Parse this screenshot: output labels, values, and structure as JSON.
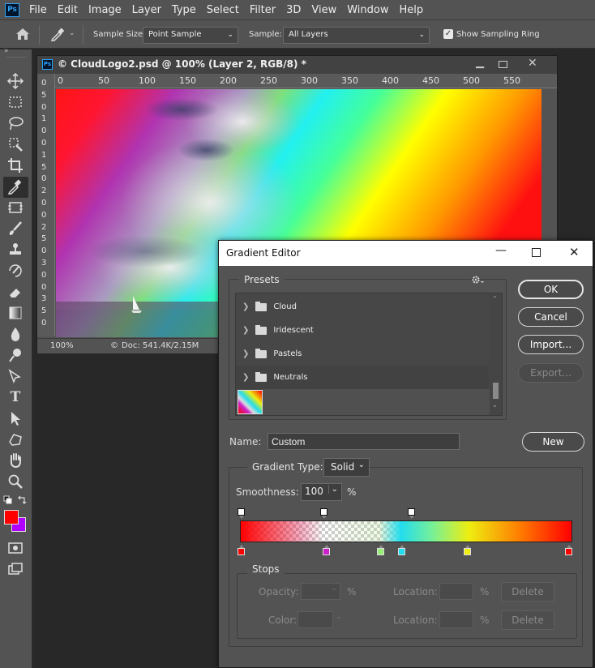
{
  "app": {
    "logo_text": "Ps"
  },
  "menu": [
    "File",
    "Edit",
    "Image",
    "Layer",
    "Type",
    "Select",
    "Filter",
    "3D",
    "View",
    "Window",
    "Help"
  ],
  "options_bar": {
    "sample_size_label": "Sample Size:",
    "sample_size_value": "Point Sample",
    "sample_label": "Sample:",
    "sample_value": "All Layers",
    "show_ring_label": "Show Sampling Ring",
    "show_ring_checked": true
  },
  "document": {
    "title": "© CloudLogo2.psd @ 100% (Layer 2, RGB/8) *",
    "ruler_h": [
      "0",
      "50",
      "100",
      "150",
      "200",
      "250",
      "300",
      "350",
      "400",
      "450",
      "500",
      "550"
    ],
    "ruler_v": [
      "0",
      "5",
      "0",
      "1",
      "0",
      "0",
      "1",
      "5",
      "0",
      "2",
      "0",
      "0",
      "2",
      "5",
      "0",
      "3",
      "0",
      "0",
      "3",
      "5",
      "0"
    ],
    "zoom": "100%",
    "doc_info": "Doc: 541.4K/2.15M"
  },
  "gradient_editor": {
    "title": "Gradient Editor",
    "presets_label": "Presets",
    "preset_folders": [
      "Cloud",
      "Iridescent",
      "Pastels",
      "Neutrals"
    ],
    "buttons": {
      "ok": "OK",
      "cancel": "Cancel",
      "import": "Import...",
      "export": "Export...",
      "new": "New"
    },
    "name_label": "Name:",
    "name_value": "Custom",
    "gradient_type_label": "Gradient Type:",
    "gradient_type_value": "Solid",
    "smoothness_label": "Smoothness:",
    "smoothness_value": "100",
    "smoothness_unit": "%",
    "color_stops": [
      {
        "position": 0.0,
        "color": "#ff0000"
      },
      {
        "position": 0.25,
        "color": "#cc22cc"
      },
      {
        "position": 0.42,
        "color": "#99ee77"
      },
      {
        "position": 0.485,
        "color": "#22ddee"
      },
      {
        "position": 0.69,
        "color": "#eeee11"
      },
      {
        "position": 1.0,
        "color": "#ff0000"
      }
    ],
    "opacity_stops": [
      0.0,
      0.25,
      0.5
    ],
    "stops": {
      "label": "Stops",
      "opacity_label": "Opacity:",
      "opacity_unit": "%",
      "color_label": "Color:",
      "location_label": "Location:",
      "location_unit": "%",
      "delete_label": "Delete"
    }
  },
  "colors": {
    "foreground": "#ff0000",
    "background": "#b000ff"
  }
}
